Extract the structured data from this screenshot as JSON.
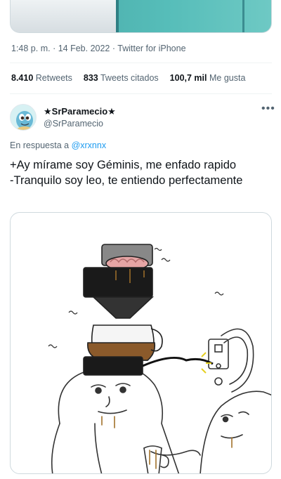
{
  "meta": {
    "time": "1:48 p. m.",
    "separator1": " · ",
    "date": "14 Feb. 2022",
    "separator2": " · ",
    "source": "Twitter for iPhone"
  },
  "stats": {
    "retweets_count": "8.410",
    "retweets_label": "Retweets",
    "quotes_count": "833",
    "quotes_label": "Tweets citados",
    "likes_count": "100,7 mil",
    "likes_label": "Me gusta"
  },
  "reply": {
    "display_name": "★SrParamecio★",
    "handle": "@SrParamecio",
    "more_icon": "more-icon",
    "in_reply_prefix": "En respuesta a ",
    "in_reply_handle": "@xrxnnx",
    "text": "+Ay mírame soy Géminis, me enfado rapido\n-Tranquilo soy leo, te entiendo perfectamente"
  },
  "colors": {
    "link": "#1d9bf0",
    "secondary_text": "#536471",
    "primary_text": "#0f1419",
    "divider": "#eff3f4"
  }
}
